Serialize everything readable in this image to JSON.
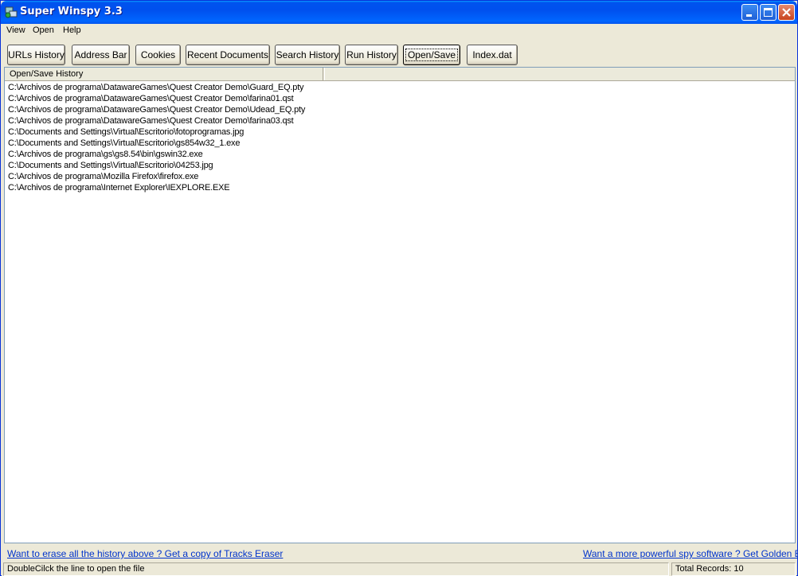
{
  "window": {
    "title": "Super Winspy 3.3"
  },
  "menu": [
    "View",
    "Open",
    "Help"
  ],
  "toolbar": [
    {
      "label": "URLs History"
    },
    {
      "label": "Address Bar"
    },
    {
      "label": "Cookies"
    },
    {
      "label": "Recent Documents"
    },
    {
      "label": "Search History"
    },
    {
      "label": "Run History"
    },
    {
      "label": "Open/Save",
      "active": true
    },
    {
      "label": "Index.dat"
    }
  ],
  "list": {
    "column": "Open/Save History",
    "rows": [
      "C:\\Archivos de programa\\DatawareGames\\Quest Creator Demo\\Guard_EQ.pty",
      "C:\\Archivos de programa\\DatawareGames\\Quest Creator Demo\\farina01.qst",
      "C:\\Archivos de programa\\DatawareGames\\Quest Creator Demo\\Udead_EQ.pty",
      "C:\\Archivos de programa\\DatawareGames\\Quest Creator Demo\\farina03.qst",
      "C:\\Documents and Settings\\Virtual\\Escritorio\\fotoprogramas.jpg",
      "C:\\Documents and Settings\\Virtual\\Escritorio\\gs854w32_1.exe",
      "C:\\Archivos de programa\\gs\\gs8.54\\bin\\gswin32.exe",
      "C:\\Documents and Settings\\Virtual\\Escritorio\\04253.jpg",
      "C:\\Archivos de programa\\Mozilla Firefox\\firefox.exe",
      "C:\\Archivos de programa\\Internet Explorer\\IEXPLORE.EXE"
    ]
  },
  "footer": {
    "left_link": "Want to erase all the history above ?   Get a copy of Tracks Eraser",
    "right_link": "Want a more powerful spy software ? Get  Golden Eye"
  },
  "status": {
    "hint": "DoubleCilck the line to open the file",
    "records": "Total Records: 10"
  },
  "colors": {
    "titlebar": "#0053ee",
    "link": "#0033cc"
  }
}
